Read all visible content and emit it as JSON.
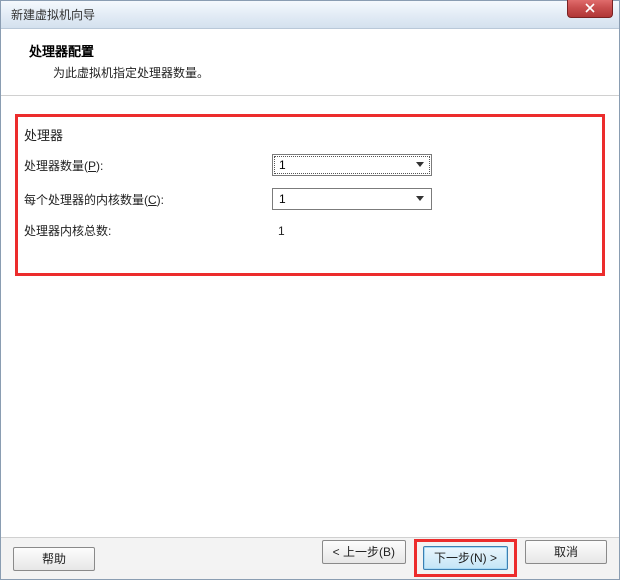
{
  "window": {
    "title": "新建虚拟机向导"
  },
  "header": {
    "title": "处理器配置",
    "subtitle": "为此虚拟机指定处理器数量。"
  },
  "processor": {
    "section_label": "处理器",
    "count_label": "处理器数量(",
    "count_accel": "P",
    "count_label_suffix": "):",
    "count_value": "1",
    "cores_label": "每个处理器的内核数量(",
    "cores_accel": "C",
    "cores_label_suffix": "):",
    "cores_value": "1",
    "total_label": "处理器内核总数:",
    "total_value": "1"
  },
  "buttons": {
    "help": "帮助",
    "back": "< 上一步(B)",
    "next": "下一步(N) >",
    "cancel": "取消"
  }
}
